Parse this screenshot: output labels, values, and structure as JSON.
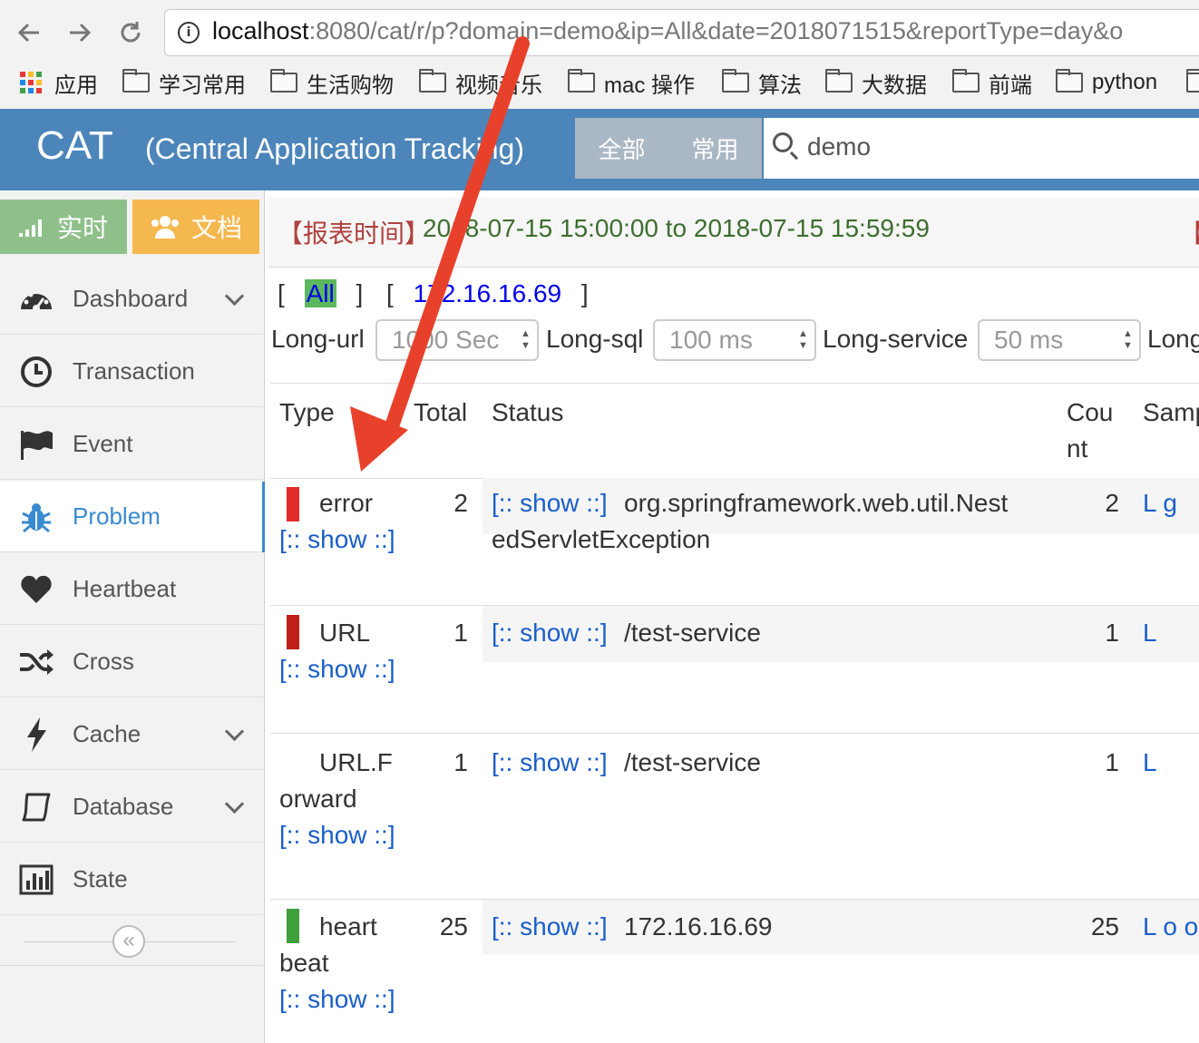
{
  "browser": {
    "url_host": "localhost",
    "url_rest": ":8080/cat/r/p?domain=demo&ip=All&date=2018071515&reportType=day&o",
    "bookmarks": [
      {
        "label": "应用",
        "icon": "apps-grid-icon"
      },
      {
        "label": "学习常用",
        "icon": "folder-icon"
      },
      {
        "label": "生活购物",
        "icon": "folder-icon"
      },
      {
        "label": "视频音乐",
        "icon": "folder-icon"
      },
      {
        "label": "mac 操作",
        "icon": "folder-icon"
      },
      {
        "label": "算法",
        "icon": "folder-icon"
      },
      {
        "label": "大数据",
        "icon": "folder-icon"
      },
      {
        "label": "前端",
        "icon": "folder-icon"
      },
      {
        "label": "python",
        "icon": "folder-icon"
      }
    ]
  },
  "header": {
    "logo": "CAT",
    "subtitle": "(Central Application Tracking)",
    "tabs": [
      "全部",
      "常用"
    ],
    "search_value": "demo",
    "color": "#4c85b9"
  },
  "sidebar": {
    "realtime_label": "实时",
    "docs_label": "文档",
    "items": [
      {
        "label": "Dashboard",
        "icon": "dashboard-icon",
        "expandable": true
      },
      {
        "label": "Transaction",
        "icon": "clock-icon",
        "expandable": false
      },
      {
        "label": "Event",
        "icon": "flag-icon",
        "expandable": false
      },
      {
        "label": "Problem",
        "icon": "bug-icon",
        "expandable": false,
        "active": true
      },
      {
        "label": "Heartbeat",
        "icon": "heart-icon",
        "expandable": false
      },
      {
        "label": "Cross",
        "icon": "shuffle-icon",
        "expandable": false
      },
      {
        "label": "Cache",
        "icon": "bolt-icon",
        "expandable": true
      },
      {
        "label": "Database",
        "icon": "database-icon",
        "expandable": true
      },
      {
        "label": "State",
        "icon": "bar-chart-icon",
        "expandable": false
      }
    ],
    "collapse_label": "«"
  },
  "report": {
    "time_label": "【报表时间】",
    "time_range": "2018-07-15 15:00:00 to 2018-07-15 15:59:59",
    "right_label": "【"
  },
  "ip_filter": {
    "open1": "[",
    "all": "All",
    "close1": "]",
    "open2": "[",
    "ip": "172.16.16.69",
    "close2": "]"
  },
  "thresholds": [
    {
      "label": "Long-url",
      "value": "1000 Sec"
    },
    {
      "label": "Long-sql",
      "value": "100 ms"
    },
    {
      "label": "Long-service",
      "value": "50 ms"
    },
    {
      "label": "Long",
      "value": ""
    }
  ],
  "table": {
    "headers": {
      "type": "Type",
      "total": "Total",
      "status": "Status",
      "count_1": "Cou",
      "count_2": "nt",
      "sample": "Samp"
    },
    "show_label": "[:: show ::]",
    "rows": [
      {
        "type_1": "error",
        "type_rest": "",
        "total": "2",
        "status_1": "org.springframework.web.util.Nest",
        "status_2": "edServletException",
        "count": "2",
        "sample": "L g",
        "color": "#e32b2b"
      },
      {
        "type_1": "URL",
        "type_rest": "",
        "total": "1",
        "status_1": "/test-service",
        "status_2": "",
        "count": "1",
        "sample": "L",
        "color": "#c0201b"
      },
      {
        "type_1": "URL.F",
        "type_rest": "orward",
        "total": "1",
        "status_1": "/test-service",
        "status_2": "",
        "count": "1",
        "sample": "L",
        "color": "#ffffff"
      },
      {
        "type_1": "heart",
        "type_rest": "beat",
        "total": "25",
        "status_1": "172.16.16.69",
        "status_2": "",
        "count": "25",
        "sample": "L o o",
        "color": "#3fa03b"
      }
    ]
  },
  "annotation_arrow_color": "#e8412b"
}
